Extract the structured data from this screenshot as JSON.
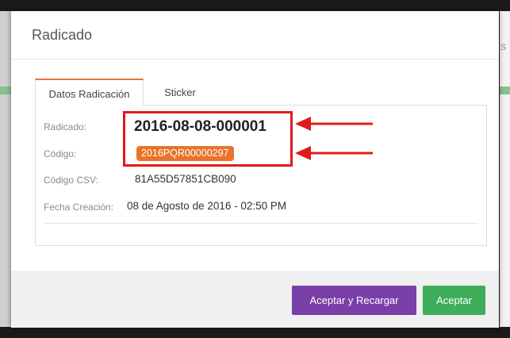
{
  "background": {
    "edge_letter": "s"
  },
  "modal": {
    "title": "Radicado",
    "tabs": [
      {
        "label": "Datos Radicación",
        "active": true
      },
      {
        "label": "Sticker",
        "active": false
      }
    ],
    "fields": {
      "radicado": {
        "label": "Radicado:",
        "value": "2016-08-08-000001"
      },
      "codigo": {
        "label": "Código:",
        "value": "2016PQR00000297"
      },
      "codigo_csv": {
        "label": "Código CSV:",
        "value": "81A55D57851CB090"
      },
      "fecha_creacion": {
        "label": "Fecha Creación:",
        "value": "08 de Agosto de 2016 - 02:50 PM"
      }
    },
    "footer": {
      "accept_reload_label": "Aceptar y Recargar",
      "accept_label": "Aceptar"
    }
  },
  "annotations": {
    "highlight_color": "#e01b1b",
    "arrow_icon": "left-arrow-icon"
  },
  "colors": {
    "accent_tab": "#e8743b",
    "badge": "#e8742a",
    "button_purple": "#7b3fa8",
    "button_green": "#3fae5a"
  }
}
